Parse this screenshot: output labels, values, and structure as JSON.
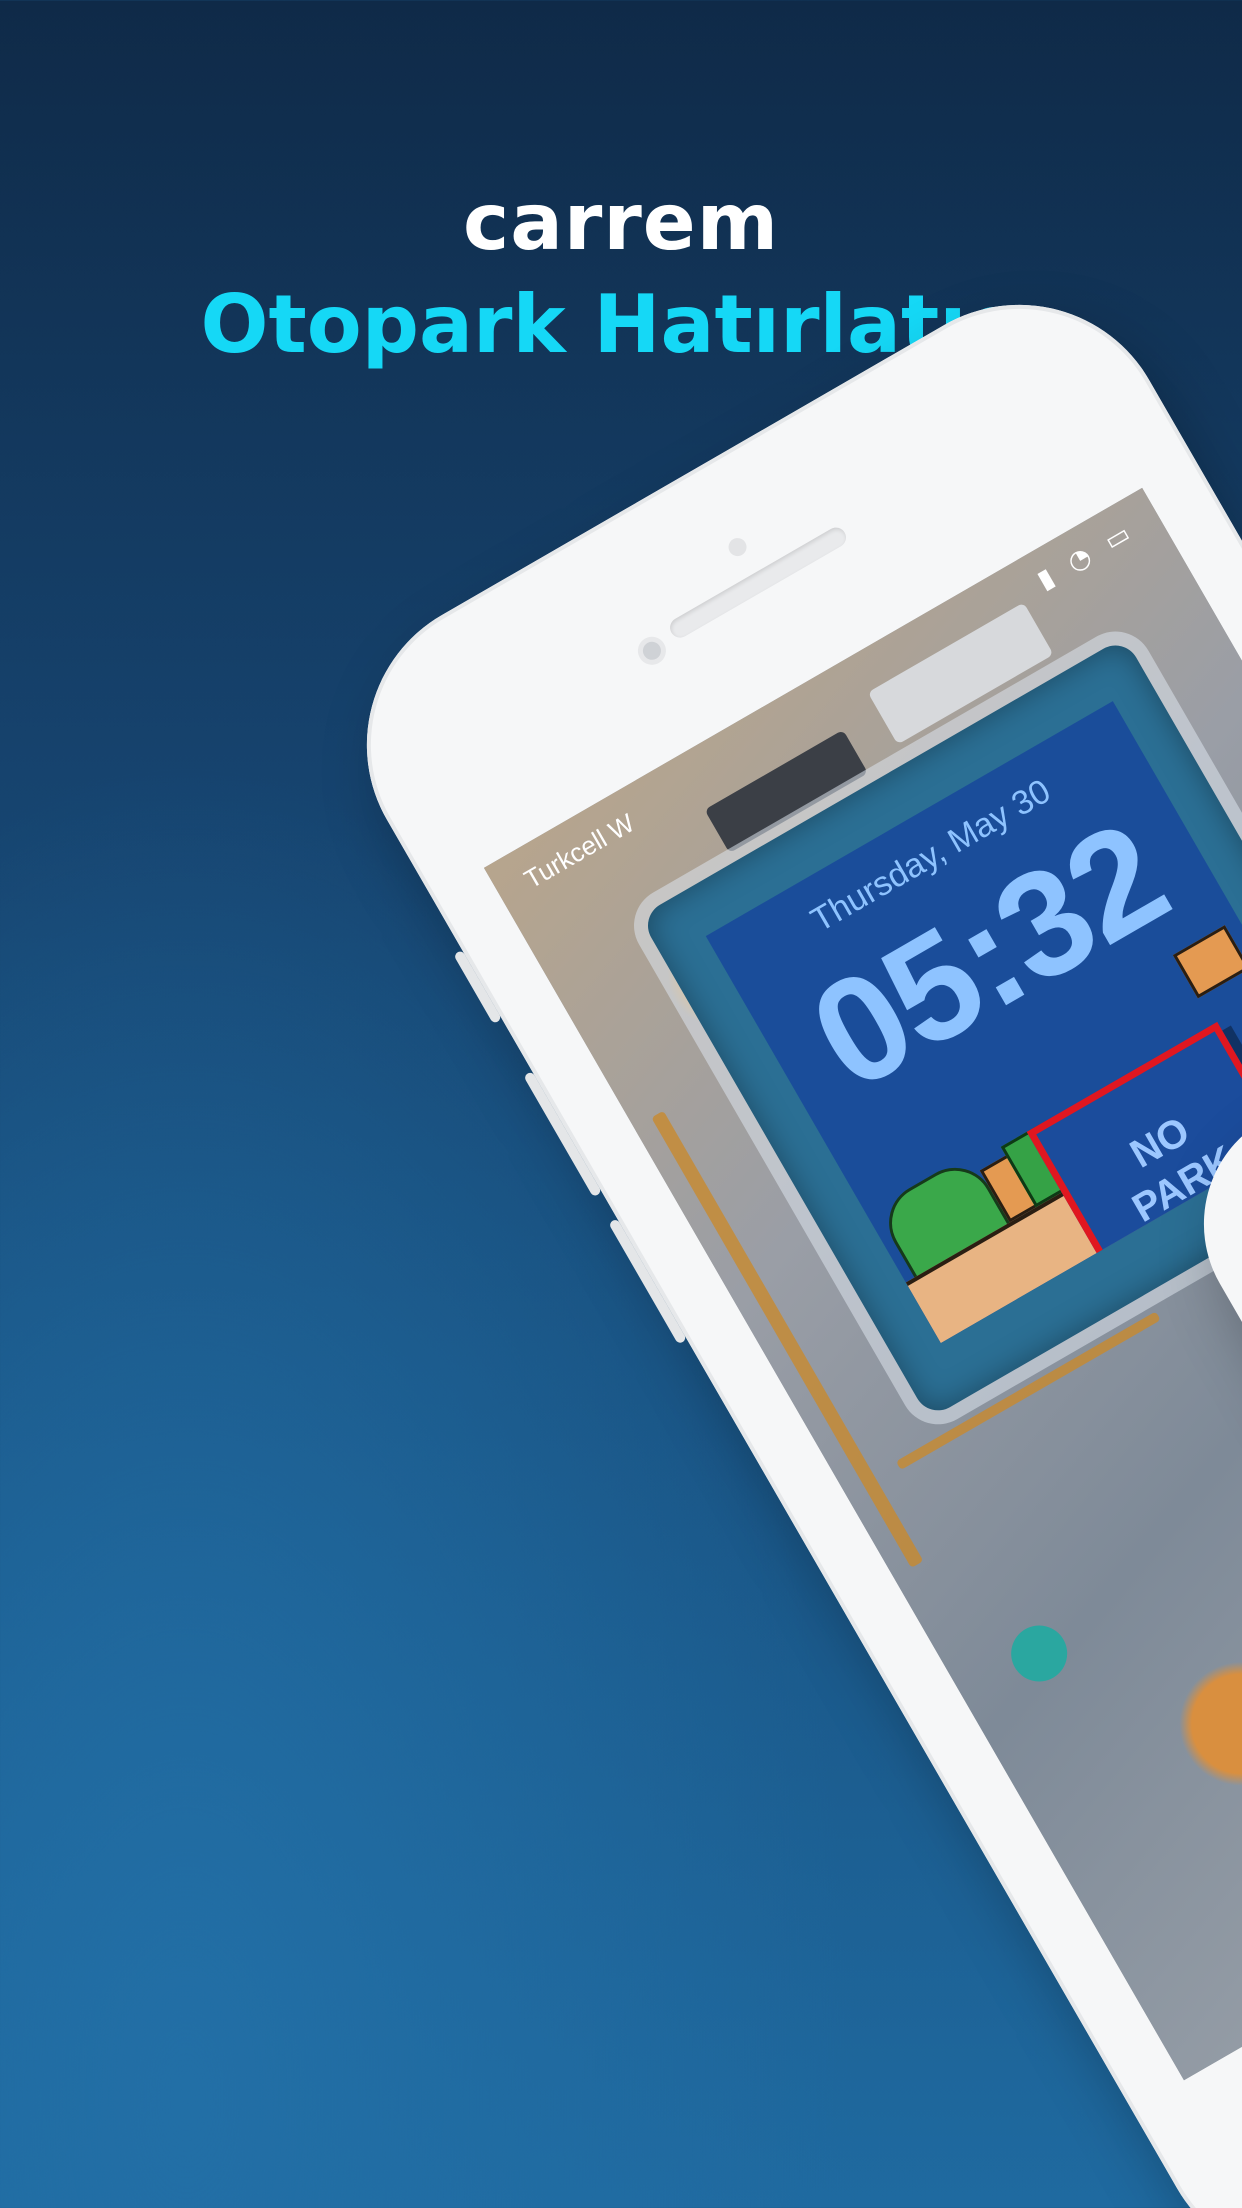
{
  "header": {
    "brand": "carrem",
    "subtitle": "Otopark Hatırlatıcı"
  },
  "lock_screen": {
    "carrier": "Turkcell W",
    "status_icons": "▮ ◔ ▭",
    "date": "Thursday, May 30",
    "time": "05:32"
  },
  "widget": {
    "line1": "NO",
    "line2": "PARK"
  },
  "colors": {
    "brand_text": "#ffffff",
    "subtitle_text": "#15d8f6",
    "widget_border": "#e01720",
    "background_top": "#0f2a48",
    "background_bottom": "#1f6aa0"
  }
}
